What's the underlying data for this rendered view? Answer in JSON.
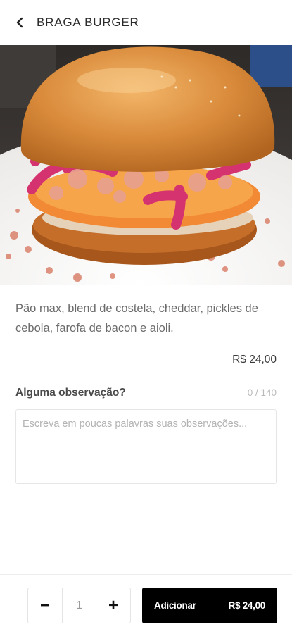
{
  "header": {
    "title": "BRAGA BURGER",
    "back_icon": "chevron-left-icon"
  },
  "product": {
    "image_alt": "burger-photo",
    "description": "Pão max, blend de costela, cheddar, pickles de cebola, farofa de bacon e aioli.",
    "price": "R$ 24,00"
  },
  "observation": {
    "label": "Alguma observação?",
    "counter": "0 / 140",
    "placeholder": "Escreva em poucas palavras suas observações...",
    "value": ""
  },
  "footer": {
    "minus_label": "−",
    "quantity": "1",
    "plus_label": "+",
    "add_label": "Adicionar",
    "add_price": "R$ 24,00"
  }
}
